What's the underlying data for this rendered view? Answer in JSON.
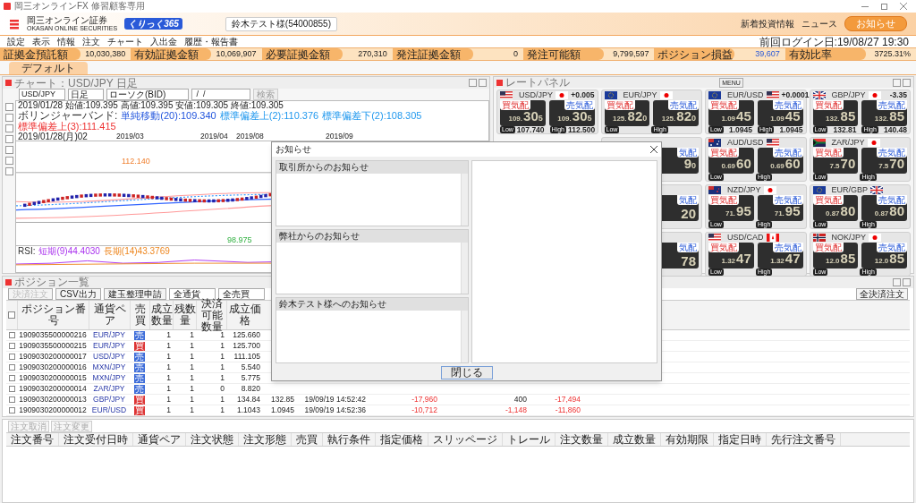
{
  "window": {
    "title": "岡三オンラインFX 修習顧客専用"
  },
  "header": {
    "logo_company": "岡三オンライン証券",
    "logo_company_en": "OKASAN ONLINE SECURITIES",
    "logo_brand": "くりっく365",
    "account": "鈴木テスト様(54000855)",
    "links": [
      "新着投資情報",
      "ニュース"
    ],
    "notice_button": "お知らせ"
  },
  "menu": [
    "設定",
    "表示",
    "情報",
    "注文",
    "チャート",
    "入出金",
    "履歴・報告書"
  ],
  "last_login": "前回ログイン日:19/08/27 19:30",
  "summary": [
    {
      "label": "証拠金預託額",
      "value": "10,030,380",
      "highlight": false
    },
    {
      "label": "有効証拠金額",
      "value": "10,069,907",
      "highlight": false
    },
    {
      "label": "必要証拠金額",
      "value": "270,310",
      "highlight": false
    },
    {
      "label": "発注証拠金額",
      "value": "0",
      "highlight": false
    },
    {
      "label": "発注可能額",
      "value": "9,799,597",
      "highlight": false
    },
    {
      "label": "ポジション損益",
      "value": "39,607",
      "highlight": true
    },
    {
      "label": "有効比率",
      "value": "3725.31%",
      "highlight": false
    }
  ],
  "workspace_tabs": [
    {
      "label": "デフォルト",
      "selected": true
    }
  ],
  "chart": {
    "title": "チャート：USD/JPY 日足",
    "pair": "USD/JPY",
    "period": "日足",
    "type": "ローソク(BID)",
    "date": " /  / ",
    "search_button": "検索",
    "ohlc": "2019/01/28 始値:109.395 高値:109.395 安値:109.305 終値:109.305",
    "bollinger": [
      {
        "text": "ボリンジャーバンド:"
      },
      {
        "text": "単純移動(20):109.340",
        "color": "#2255dd"
      },
      {
        "text": "標準偏差上(2):110.376",
        "color": "#2299ee"
      },
      {
        "text": "標準偏差下(2):108.305",
        "color": "#2299ee"
      },
      {
        "text": "標準偏差上(3):111.415",
        "color": "#ee3333"
      }
    ],
    "dates": [
      "2019/01/28(月)02",
      "2019/03",
      "2019/04",
      "2019/08",
      "2019/09"
    ],
    "high_label": "112.140",
    "low_label": "98.975",
    "rsi": [
      {
        "text": "RSI:"
      },
      {
        "text": "短期(9)44.4030",
        "color": "#aa33ee"
      },
      {
        "text": "長期(14)43.3769",
        "color": "#ee8822"
      }
    ]
  },
  "rate_panel": {
    "title": "レートパネル",
    "menu_button": "MENU",
    "tiles": [
      {
        "kind": "full",
        "pair": "USD/JPY",
        "flags": [
          {
            "kind": "us"
          },
          {
            "kind": "jp"
          }
        ],
        "change": "+0.005",
        "bid": {
          "label": "買気配",
          "prefix": "109.",
          "big": "30",
          "small": "5"
        },
        "ask": {
          "label": "売気配",
          "prefix": "109.",
          "big": "30",
          "small": "5"
        },
        "low_label": "Low",
        "low": "107.740",
        "high_label": "High",
        "high": "112.500"
      },
      {
        "kind": "full",
        "pair": "EUR/JPY",
        "flags": [
          {
            "kind": "eu"
          },
          {
            "kind": "jp"
          }
        ],
        "bid": {
          "label": "買気配",
          "prefix": "125.",
          "big": "82",
          "small": "0"
        },
        "ask": {
          "label": "売気配",
          "prefix": "125.",
          "big": "82",
          "small": "0"
        },
        "low_label": "Low",
        "high_label": "High"
      },
      {
        "kind": "full",
        "pair": "EUR/USD",
        "flags": [
          {
            "kind": "eu"
          },
          {
            "kind": "us"
          }
        ],
        "change": "+0.0001",
        "bid": {
          "label": "買気配",
          "prefix": "1.09",
          "big": "45"
        },
        "ask": {
          "label": "売気配",
          "prefix": "1.09",
          "big": "45"
        },
        "low_label": "Low",
        "low": "1.0945",
        "high_label": "High",
        "high": "1.0945"
      },
      {
        "kind": "full",
        "pair": "GBP/JPY",
        "flags": [
          {
            "kind": "gb"
          },
          {
            "kind": "jp"
          }
        ],
        "change": "-3.35",
        "bid": {
          "label": "買気配",
          "prefix": "132.",
          "big": "85"
        },
        "ask": {
          "label": "売気配",
          "prefix": "132.",
          "big": "85"
        },
        "low_label": "Low",
        "low": "132.81",
        "high_label": "High",
        "high": "140.48"
      },
      {
        "kind": "partial",
        "ask": {
          "label": "気配",
          "big": "9",
          "small": "0"
        }
      },
      {
        "kind": "full",
        "pair": "AUD/USD",
        "flags": [
          {
            "kind": "au"
          },
          {
            "kind": "us"
          }
        ],
        "bid": {
          "label": "買気配",
          "prefix": "0.69",
          "big": "60"
        },
        "ask": {
          "label": "売気配",
          "prefix": "0.69",
          "big": "60"
        },
        "low_label": "Low",
        "high_label": "High"
      },
      {
        "kind": "full",
        "pair": "ZAR/JPY",
        "flags": [
          {
            "kind": "za"
          },
          {
            "kind": "jp"
          }
        ],
        "bid": {
          "label": "買気配",
          "prefix": "7.5",
          "big": "70"
        },
        "ask": {
          "label": "売気配",
          "prefix": "7.5",
          "big": "70"
        },
        "low_label": "Low",
        "high_label": "High"
      },
      {
        "kind": "partial",
        "ask": {
          "label": "気配",
          "big": "20"
        }
      },
      {
        "kind": "full",
        "pair": "NZD/JPY",
        "flags": [
          {
            "kind": "nz"
          },
          {
            "kind": "jp"
          }
        ],
        "bid": {
          "label": "買気配",
          "prefix": "71.",
          "big": "95"
        },
        "ask": {
          "label": "売気配",
          "prefix": "71.",
          "big": "95"
        },
        "low_label": "Low",
        "high_label": "High"
      },
      {
        "kind": "full",
        "pair": "EUR/GBP",
        "flags": [
          {
            "kind": "eu"
          },
          {
            "kind": "gb"
          }
        ],
        "bid": {
          "label": "買気配",
          "prefix": "0.87",
          "big": "80"
        },
        "ask": {
          "label": "売気配",
          "prefix": "0.87",
          "big": "80"
        },
        "low_label": "Low",
        "high_label": "High"
      },
      {
        "kind": "partial",
        "ask": {
          "label": "気配",
          "big": "78"
        }
      },
      {
        "kind": "full",
        "pair": "USD/CAD",
        "flags": [
          {
            "kind": "us"
          },
          {
            "kind": "ca"
          }
        ],
        "bid": {
          "label": "買気配",
          "prefix": "1.32",
          "big": "47"
        },
        "ask": {
          "label": "売気配",
          "prefix": "1.32",
          "big": "47"
        },
        "low_label": "Low",
        "high_label": "High"
      },
      {
        "kind": "full",
        "pair": "NOK/JPY",
        "flags": [
          {
            "kind": "no"
          },
          {
            "kind": "jp"
          }
        ],
        "bid": {
          "label": "買気配",
          "prefix": "12.0",
          "big": "85"
        },
        "ask": {
          "label": "売気配",
          "prefix": "12.0",
          "big": "85"
        },
        "low_label": "Low",
        "high_label": "High"
      }
    ]
  },
  "positions": {
    "title": "ポジション一覧",
    "toolbar": [
      {
        "label": "決済注文",
        "kind": "dropdown",
        "disabled": true
      },
      {
        "label": "CSV出力",
        "kind": "button",
        "disabled": false
      },
      {
        "label": "建玉整理申請",
        "kind": "button",
        "disabled": false
      },
      {
        "label": "全通貨",
        "kind": "select",
        "disabled": false
      },
      {
        "label": "全売買",
        "kind": "select",
        "disabled": false
      }
    ],
    "close_all_button": "全決済注文",
    "all_checked": false,
    "columns": [
      "ポジション番号",
      "通貨ペア",
      "売買",
      "成立数量",
      "残数量",
      "決済可能数量",
      "成立価格"
    ],
    "rows": [
      {
        "checked": false,
        "id": "1909035500000216",
        "pair": "EUR/JPY",
        "side": {
          "label": "売",
          "kind": "sell"
        },
        "qty": "1",
        "remaining": "1",
        "closable": "1",
        "price": "125.660"
      },
      {
        "checked": false,
        "id": "1909035500000215",
        "pair": "EUR/JPY",
        "side": {
          "label": "買",
          "kind": "buy"
        },
        "qty": "1",
        "remaining": "1",
        "closable": "1",
        "price": "125.700"
      },
      {
        "checked": false,
        "id": "1909030200000017",
        "pair": "USD/JPY",
        "side": {
          "label": "売",
          "kind": "sell"
        },
        "qty": "1",
        "remaining": "1",
        "closable": "1",
        "price": "111.105"
      },
      {
        "checked": false,
        "id": "1909030200000016",
        "pair": "MXN/JPY",
        "side": {
          "label": "売",
          "kind": "sell"
        },
        "qty": "1",
        "remaining": "1",
        "closable": "1",
        "price": "5.540"
      },
      {
        "checked": false,
        "id": "1909030200000015",
        "pair": "MXN/JPY",
        "side": {
          "label": "売",
          "kind": "sell"
        },
        "qty": "1",
        "remaining": "1",
        "closable": "1",
        "price": "5.775"
      },
      {
        "checked": false,
        "id": "1909030200000014",
        "pair": "ZAR/JPY",
        "side": {
          "label": "売",
          "kind": "sell"
        },
        "qty": "1",
        "remaining": "1",
        "closable": "0",
        "price": "8.820"
      },
      {
        "checked": false,
        "id": "1909030200000013",
        "pair": "GBP/JPY",
        "side": {
          "label": "買",
          "kind": "buy"
        },
        "qty": "1",
        "remaining": "1",
        "closable": "1",
        "price": "134.84",
        "more": [
          {
            "text": "132.85",
            "negative": false
          },
          {
            "text": "19/09/19 14:52:42",
            "negative": false
          },
          {
            "text": "-17,960",
            "negative": true
          },
          {
            "text": "400",
            "negative": false
          },
          {
            "text": "-17,494",
            "negative": true
          }
        ]
      },
      {
        "checked": false,
        "id": "1909030200000012",
        "pair": "EUR/USD",
        "side": {
          "label": "買",
          "kind": "buy"
        },
        "qty": "1",
        "remaining": "1",
        "closable": "1",
        "price": "1.1043",
        "more": [
          {
            "text": "1.0945",
            "negative": false
          },
          {
            "text": "19/09/19 14:52:36",
            "negative": false
          },
          {
            "text": "-10,712",
            "negative": true
          },
          {
            "text": "-1,148",
            "negative": true
          },
          {
            "text": "-11,860",
            "negative": true
          }
        ]
      }
    ]
  },
  "orders": {
    "buttons": [
      "注文取消",
      "注文変更"
    ],
    "columns": [
      "注文番号",
      "注文受付日時",
      "通貨ペア",
      "注文状態",
      "注文形態",
      "売買",
      "執行条件",
      "指定価格",
      "スリッページ",
      "トレール",
      "注文数量",
      "成立数量",
      "有効期限",
      "指定日時",
      "先行注文番号"
    ]
  },
  "dialog": {
    "title": "お知らせ",
    "sections": [
      "取引所からのお知らせ",
      "弊社からのお知らせ",
      "鈴木テスト様へのお知らせ"
    ],
    "close_button": "閉じる"
  }
}
